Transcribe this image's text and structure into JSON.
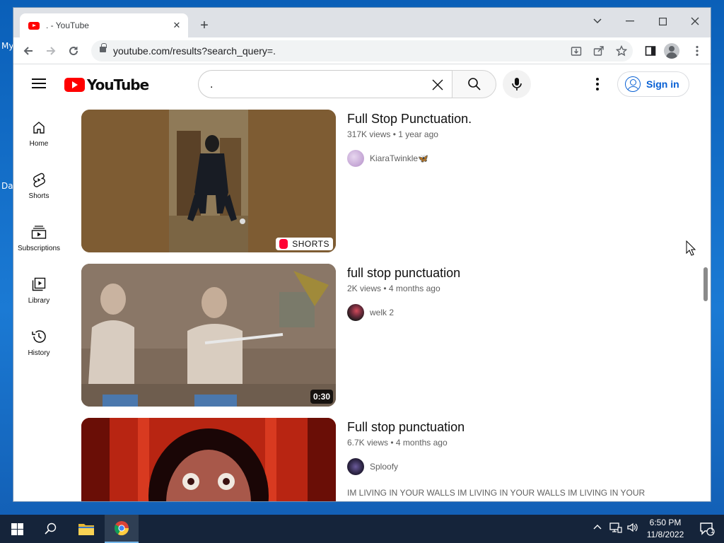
{
  "desktop": {
    "label_1": "My",
    "label_2": "Da"
  },
  "browser": {
    "tab_title": ". - YouTube",
    "tab_close": "✕",
    "new_tab": "+",
    "url": "youtube.com/results?search_query=."
  },
  "youtube": {
    "logo_text": "YouTube",
    "search_value": ".",
    "sign_in": "Sign in",
    "guide": [
      {
        "label": "Home"
      },
      {
        "label": "Shorts"
      },
      {
        "label": "Subscriptions"
      },
      {
        "label": "Library"
      },
      {
        "label": "History"
      }
    ],
    "results": [
      {
        "title": "Full Stop Punctuation.",
        "views": "317K views",
        "age": "1 year ago",
        "channel": "KiaraTwinkle🦋",
        "badge": "SHORTS"
      },
      {
        "title": "full stop punctuation",
        "views": "2K views",
        "age": "4 months ago",
        "channel": "welk 2",
        "badge": "0:30"
      },
      {
        "title": "Full stop punctuation",
        "views": "6.7K views",
        "age": "4 months ago",
        "channel": "Sploofy",
        "description": "IM LIVING IN YOUR WALLS IM LIVING IN YOUR WALLS IM LIVING IN YOUR WALLS IM LIVING IN YOUR WALLS IM LIVING IN ..."
      }
    ]
  },
  "taskbar": {
    "time": "6:50 PM",
    "date": "11/8/2022",
    "notification_count": "1"
  },
  "colors": {
    "accent": "#065fd4",
    "youtube_red": "#ff0000",
    "taskbar": "#15243a"
  }
}
